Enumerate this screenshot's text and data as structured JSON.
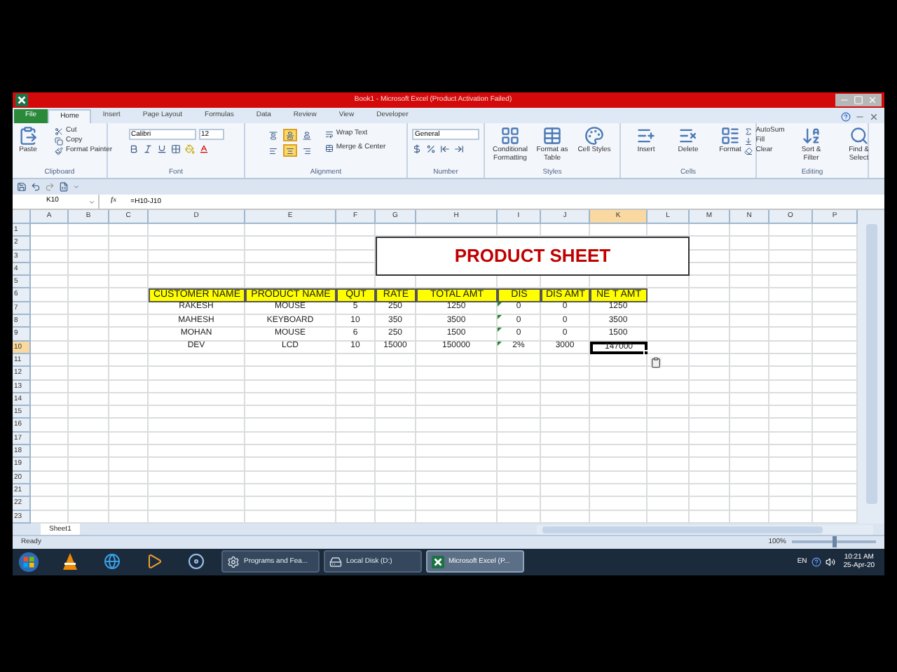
{
  "window": {
    "title": "Book1 - Microsoft Excel (Product Activation Failed)"
  },
  "tabs": [
    {
      "label": "File",
      "kind": "file",
      "selected": false
    },
    {
      "label": "Home",
      "kind": "tab",
      "selected": true
    },
    {
      "label": "Insert",
      "kind": "tab",
      "selected": false
    },
    {
      "label": "Page Layout",
      "kind": "tab",
      "selected": false
    },
    {
      "label": "Formulas",
      "kind": "tab",
      "selected": false
    },
    {
      "label": "Data",
      "kind": "tab",
      "selected": false
    },
    {
      "label": "Review",
      "kind": "tab",
      "selected": false
    },
    {
      "label": "View",
      "kind": "tab",
      "selected": false
    },
    {
      "label": "Developer",
      "kind": "tab",
      "selected": false
    }
  ],
  "ribbon": [
    {
      "kind": "clipboard",
      "label": "Clipboard",
      "large": [
        "Paste"
      ],
      "small": [
        "Cut",
        "Copy",
        "Format Painter"
      ]
    },
    {
      "kind": "font",
      "label": "Font",
      "font_name": "Calibri",
      "font_size": "12"
    },
    {
      "kind": "alignment",
      "label": "Alignment",
      "align_buttons": [
        {
          "selected": false
        },
        {
          "selected": true
        },
        {
          "selected": false
        },
        {
          "selected": false
        },
        {
          "selected": true
        },
        {
          "selected": false
        }
      ],
      "small": [
        "Wrap Text",
        "Merge & Center"
      ]
    },
    {
      "kind": "number",
      "label": "Number",
      "format": "General"
    },
    {
      "kind": "large",
      "label": "Styles",
      "large": [
        "Conditional Formatting",
        "Format as Table",
        "Cell Styles"
      ]
    },
    {
      "kind": "large",
      "label": "Cells",
      "large": [
        "Insert",
        "Delete",
        "Format"
      ]
    },
    {
      "kind": "editing",
      "label": "Editing",
      "small": [
        "AutoSum",
        "Fill",
        "Clear"
      ],
      "large": [
        "Sort & Filter",
        "Find & Select"
      ]
    }
  ],
  "formula_bar": {
    "name_box": "K10",
    "function_label": "fx",
    "formula": "=H10-J10"
  },
  "sheet": {
    "columns": [
      {
        "letter": "A",
        "selected": false
      },
      {
        "letter": "B",
        "selected": false
      },
      {
        "letter": "C",
        "selected": false
      },
      {
        "letter": "D",
        "selected": false
      },
      {
        "letter": "E",
        "selected": false
      },
      {
        "letter": "F",
        "selected": false
      },
      {
        "letter": "G",
        "selected": false
      },
      {
        "letter": "H",
        "selected": false
      },
      {
        "letter": "I",
        "selected": false
      },
      {
        "letter": "J",
        "selected": false
      },
      {
        "letter": "K",
        "selected": true
      },
      {
        "letter": "L",
        "selected": false
      },
      {
        "letter": "M",
        "selected": false
      },
      {
        "letter": "N",
        "selected": false
      },
      {
        "letter": "O",
        "selected": false
      },
      {
        "letter": "P",
        "selected": false
      }
    ],
    "title": "PRODUCT SHEET",
    "rows": [
      {
        "number": "1",
        "selected": false
      },
      {
        "number": "2",
        "selected": false
      },
      {
        "number": "3",
        "selected": false
      },
      {
        "number": "4",
        "selected": false
      },
      {
        "number": "5",
        "selected": false
      },
      {
        "number": "6",
        "selected": false,
        "kind": "header",
        "cells": [
          "CUSTOMER NAME",
          "PRODUCT NAME",
          "QUT",
          "RATE",
          "TOTAL AMT",
          "DIS",
          "DIS AMT",
          "NE T AMT"
        ]
      },
      {
        "number": "7",
        "selected": false,
        "kind": "data",
        "flag": true,
        "cells": [
          "RAKESH",
          "MOUSE",
          "5",
          "250",
          "1250",
          "0",
          "0",
          "1250"
        ]
      },
      {
        "number": "8",
        "selected": false,
        "kind": "data",
        "flag": true,
        "cells": [
          "MAHESH",
          "KEYBOARD",
          "10",
          "350",
          "3500",
          "0",
          "0",
          "3500"
        ]
      },
      {
        "number": "9",
        "selected": false,
        "kind": "data",
        "flag": true,
        "cells": [
          "MOHAN",
          "MOUSE",
          "6",
          "250",
          "1500",
          "0",
          "0",
          "1500"
        ]
      },
      {
        "number": "10",
        "selected": true,
        "kind": "data",
        "flag": true,
        "cells": [
          "DEV",
          "LCD",
          "10",
          "15000",
          "150000",
          "2%",
          "3000",
          "147000"
        ]
      },
      {
        "number": "11",
        "selected": false
      },
      {
        "number": "12",
        "selected": false
      },
      {
        "number": "13",
        "selected": false
      },
      {
        "number": "14",
        "selected": false
      },
      {
        "number": "15",
        "selected": false
      },
      {
        "number": "16",
        "selected": false
      },
      {
        "number": "17",
        "selected": false
      },
      {
        "number": "18",
        "selected": false
      },
      {
        "number": "19",
        "selected": false
      },
      {
        "number": "20",
        "selected": false
      },
      {
        "number": "21",
        "selected": false
      },
      {
        "number": "22",
        "selected": false
      },
      {
        "number": "23",
        "selected": false
      }
    ]
  },
  "sheet_tabs": [
    {
      "label": "Sheet1",
      "selected": true
    }
  ],
  "status_bar": {
    "status": "Ready",
    "zoom": "100%",
    "level": 0.5
  },
  "taskbar": {
    "buttons": [
      {
        "label": "Programs and Fea...",
        "selected": false
      },
      {
        "label": "Local Disk (D:)",
        "selected": false
      },
      {
        "label": "Microsoft Excel (P...",
        "selected": true
      }
    ],
    "language": "EN",
    "time": "10:21 AM",
    "date": "25-Apr-20"
  }
}
